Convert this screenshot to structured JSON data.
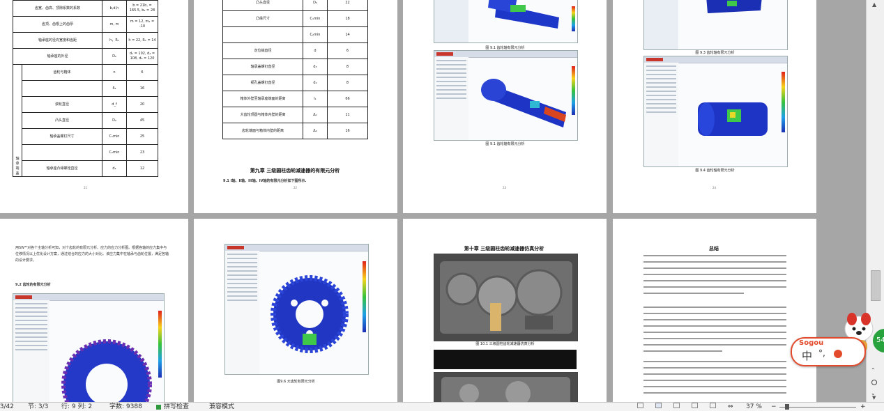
{
  "page1": {
    "table_rows": [
      {
        "label": "齿宽、齿高、顶隙系数的系数",
        "symbol": "b,d,h",
        "value": "b = 21b, = 165.5, b₂ = 28"
      },
      {
        "label": "齿顶、齿根上的齿厚",
        "symbol": "m, m",
        "value": "m = 12, m₂ = -10"
      },
      {
        "label": "轴承座的径向宽度和齿距",
        "symbol": "h，R₁",
        "value": "h = 22, R₁ = 14"
      },
      {
        "label": "轴承座的外径",
        "symbol": "D₂",
        "value": "d₁ = 102, d₂ = 108, d₃ = 120"
      },
      {
        "label": "齿轮与箱体",
        "symbol": "n",
        "value": "6"
      },
      {
        "label": "",
        "symbol": "δ₁",
        "value": "16"
      },
      {
        "label": "滚轮直径",
        "symbol": "d_f",
        "value": "20"
      },
      {
        "label": "凸头直径",
        "symbol": "D₀",
        "value": "45"
      },
      {
        "label": "轴承盖螺钉尺寸",
        "symbol": "C₁min",
        "value": "25"
      },
      {
        "label": "",
        "symbol": "C₂min",
        "value": "23"
      },
      {
        "label": "轴承座凸缘螺栓直径",
        "symbol": "d₁",
        "value": "12"
      }
    ],
    "side_label": "轴承端盖",
    "page_number": "21"
  },
  "page2": {
    "table_rows": [
      {
        "label": "凸头直径",
        "symbol": "D₀",
        "value": "22"
      },
      {
        "label": "凸缘尺寸",
        "symbol": "C₁min",
        "value": "18"
      },
      {
        "label": "",
        "symbol": "C₂min",
        "value": "14"
      },
      {
        "label": "定位销直径",
        "symbol": "d",
        "value": "6"
      },
      {
        "label": "轴承盖螺钉直径",
        "symbol": "d₃",
        "value": "8"
      },
      {
        "label": "视孔盖螺钉直径",
        "symbol": "d₄",
        "value": "8"
      },
      {
        "label": "箱体外壁至轴承座端面的距离",
        "symbol": "l₁",
        "value": "66"
      },
      {
        "label": "大齿轮顶圆与箱体内壁的距离",
        "symbol": "Δ₁",
        "value": "11"
      },
      {
        "label": "齿轮端面与箱体内壁的距离",
        "symbol": "Δ₂",
        "value": "16"
      }
    ],
    "chapter_title": "第九章 三级圆柱齿轮减速器的有限元分析",
    "section_title": "9.1  I轴、II轴、III轴、IV轴的有限元分析如下图所示.",
    "page_number": "22"
  },
  "page3": {
    "caption1": "图 9.1 齿轮轴有限元分析",
    "caption2": "图 9.1 齿轮轴有限元分析",
    "page_number": "23"
  },
  "page4": {
    "caption1": "图 9.3 齿轮轴有限元分析",
    "caption2": "图 9.4 齿轮轴有限元分析",
    "page_number": "24"
  },
  "page5": {
    "body_text": "用SW³⁰对各个主轴分析可知，对个齿轮的有限元分析、应力的应力分析图。根据各轴的应力集中与位移情况以上优化设计方案，通过结合的应力的大小对比。该应力集中在轴承与齿轮位置，满足各轴的设计要求。",
    "section_title": "9.2  齿轮的有限元分析"
  },
  "page6": {
    "caption": "图9.6 大齿轮有限元分析"
  },
  "page7": {
    "chapter_title": "第十章  三级圆柱齿轮减速器仿真分析",
    "caption": "图 10.1 三级圆柱齿轮减速器仿真分析"
  },
  "page8": {
    "title": "总结"
  },
  "status_bar": {
    "page_info": "23/42",
    "section": "节: 3/3",
    "position": "行: 9  列: 2",
    "word_count": "字数: 9388",
    "spell_check": "拼写检查",
    "compat_mode": "兼容模式",
    "zoom": "37 %"
  },
  "ime": {
    "brand": "Sogou",
    "mode": "中",
    "badge": "54"
  }
}
